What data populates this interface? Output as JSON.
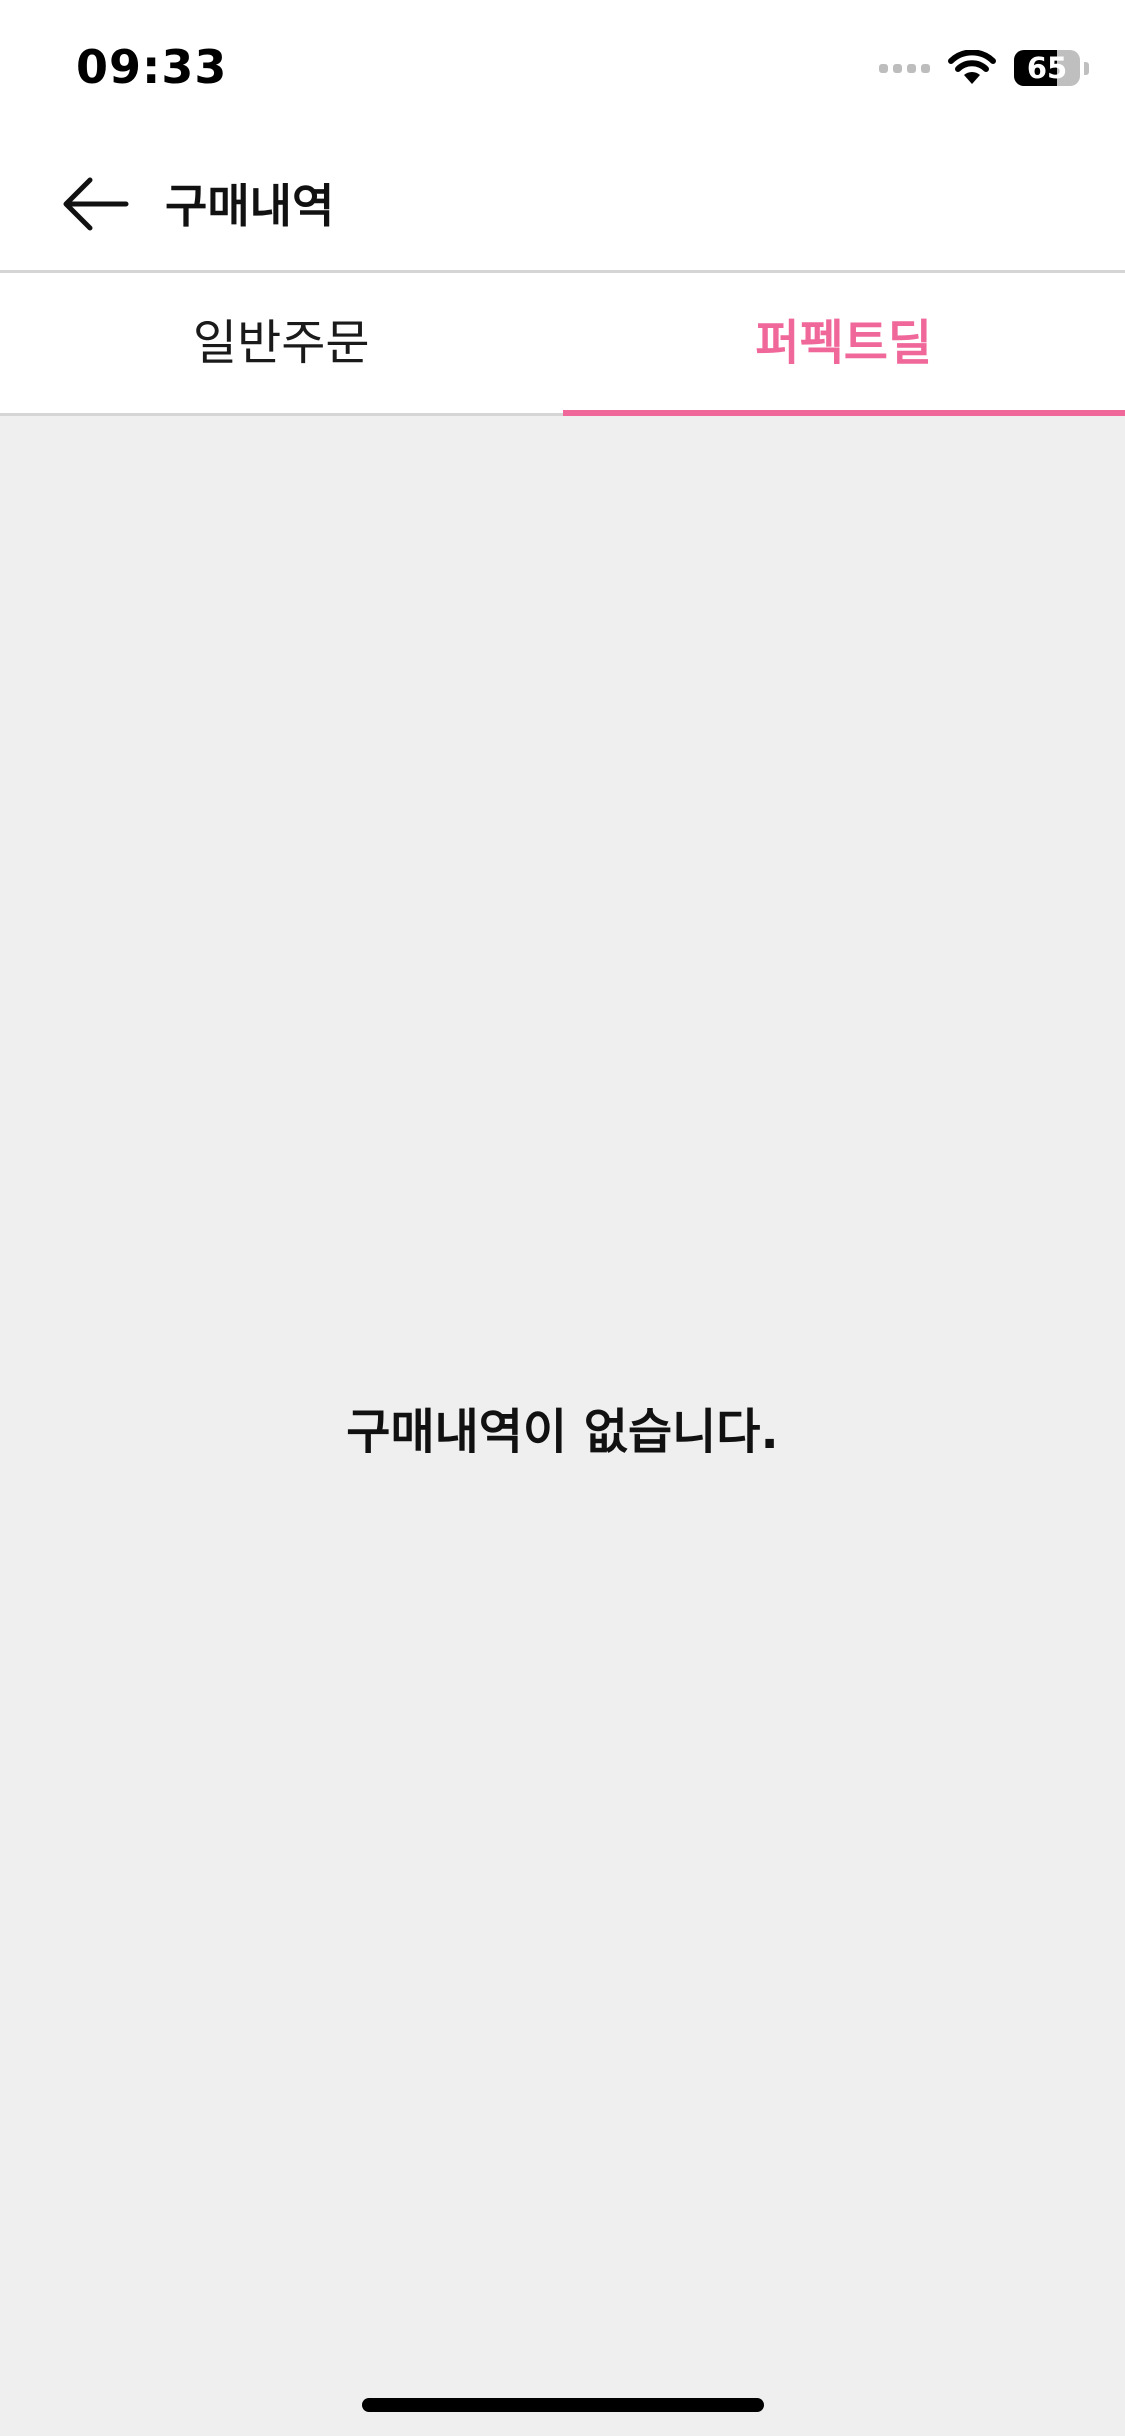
{
  "status_bar": {
    "time": "09:33",
    "battery_level": "65",
    "icons": [
      "cellular-signal-icon",
      "wifi-icon",
      "battery-icon"
    ]
  },
  "header": {
    "back_icon": "arrow-left-icon",
    "title": "구매내역"
  },
  "tabs": [
    {
      "label": "일반주문",
      "active": false
    },
    {
      "label": "퍼펙트딜",
      "active": true
    }
  ],
  "content": {
    "empty_message": "구매내역이 없습니다."
  },
  "colors": {
    "accent": "#f0679a",
    "background": "#efefef",
    "surface": "#ffffff",
    "divider": "#d5d5d5"
  }
}
